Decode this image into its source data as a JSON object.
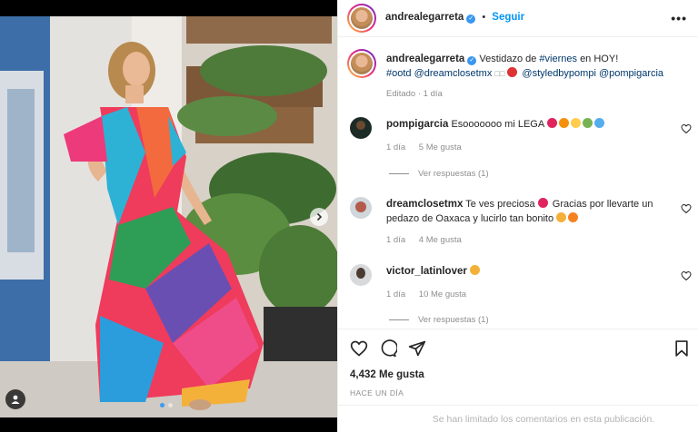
{
  "post": {
    "author": "andrealegarreta",
    "follow_label": "Seguir",
    "more_label": "•••",
    "caption_hashtag1": "#viernes",
    "caption_hashtag2": "#ootd",
    "caption_text_a": "Vestidazo de",
    "caption_text_b": "en HOY!",
    "caption_mention1": "@dreamclosetmx",
    "caption_mention2": "@styledbypompi",
    "caption_mention3": "@pompigarcia",
    "caption_edited": "Editado · 1 día",
    "likes": "4,432 Me gusta",
    "time_ago": "HACE UN DÍA",
    "comments_limited": "Se han limitado los comentarios en esta publicación."
  },
  "comments": [
    {
      "user": "pompigarcia",
      "text": "Esooooooo mi LEGA",
      "age": "1 día",
      "likes": "5 Me gusta",
      "replies": "Ver respuestas (1)",
      "emoji_colors": [
        "#e0245e",
        "#f4900c",
        "#ffcc4d",
        "#77b255",
        "#55acee"
      ]
    },
    {
      "user": "dreamclosetmx",
      "text": "Te ves preciosa",
      "text_b": "Gracias por llevarte un pedazo de Oaxaca y lucirlo tan bonito",
      "age": "1 día",
      "likes": "4 Me gusta"
    },
    {
      "user": "victor_latinlover",
      "age": "1 día",
      "likes": "10 Me gusta",
      "replies": "Ver respuestas (1)"
    }
  ],
  "colors": {
    "accent": "#0095f6",
    "verified": "#3897f0",
    "muted": "#8e8e8e"
  },
  "icons": [
    "more-icon",
    "verified-icon",
    "heart-icon",
    "comment-icon",
    "share-icon",
    "save-icon",
    "next-arrow-icon",
    "tag-user-icon"
  ]
}
